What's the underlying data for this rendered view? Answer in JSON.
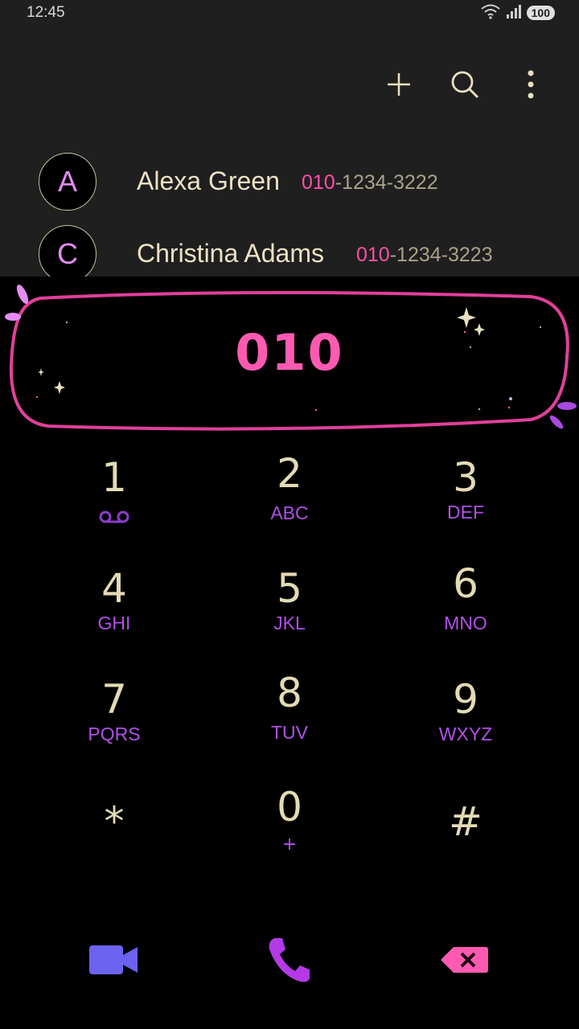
{
  "status_bar": {
    "time": "12:45",
    "battery": "100",
    "icons": [
      "wifi-icon",
      "signal-icon"
    ]
  },
  "toolbar": {
    "icons": [
      "add-icon",
      "search-icon",
      "more-vert-icon"
    ]
  },
  "contacts": [
    {
      "initial": "A",
      "name": "Alexa Green",
      "number_match": "010",
      "number_rest": "-1234-3222"
    },
    {
      "initial": "C",
      "name": "Christina Adams",
      "number_match": "010",
      "number_rest": "-1234-3223"
    }
  ],
  "dialer": {
    "input_value": "010"
  },
  "keypad": [
    {
      "digit": "1",
      "letters": ""
    },
    {
      "digit": "2",
      "letters": "ABC"
    },
    {
      "digit": "3",
      "letters": "DEF"
    },
    {
      "digit": "4",
      "letters": "GHI"
    },
    {
      "digit": "5",
      "letters": "JKL"
    },
    {
      "digit": "6",
      "letters": "MNO"
    },
    {
      "digit": "7",
      "letters": "PQRS"
    },
    {
      "digit": "8",
      "letters": "TUV"
    },
    {
      "digit": "9",
      "letters": "WXYZ"
    },
    {
      "digit": "*",
      "letters": ""
    },
    {
      "digit": "0",
      "letters": "+"
    },
    {
      "digit": "#",
      "letters": ""
    }
  ],
  "actions": {
    "icons": [
      "video-call-icon",
      "phone-icon",
      "backspace-icon"
    ]
  },
  "colors": {
    "accent_pink": "#ff5ab2",
    "accent_purple": "#b050e8",
    "video_blue": "#6b63f0",
    "digit_cream": "#e3dbb5"
  }
}
